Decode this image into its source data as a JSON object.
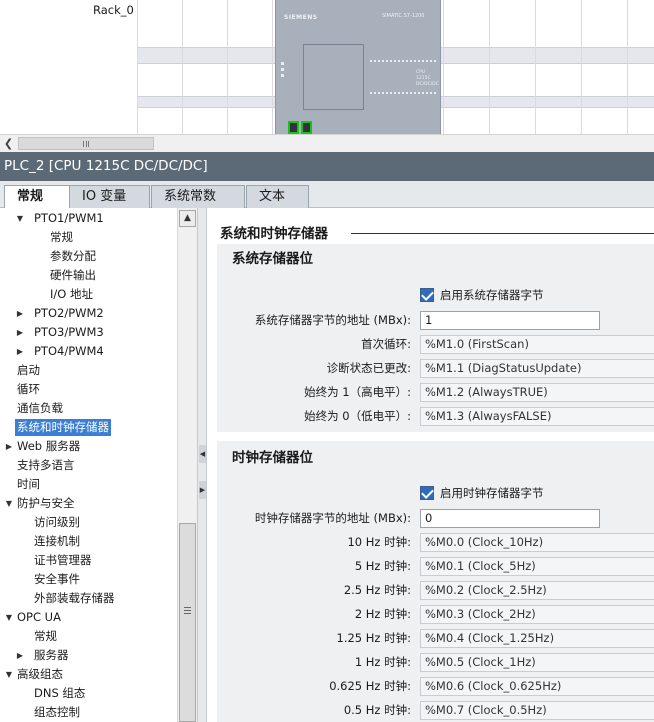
{
  "device_view": {
    "rack_label": "Rack_0",
    "plc_brand": "SIEMENS",
    "plc_model": "SIMATIC S7-1200",
    "plc_text": "CPU 1215C DC/DC/DC"
  },
  "title_bar": {
    "title": "PLC_2 [CPU 1215C DC/DC/DC]"
  },
  "tabs": [
    {
      "label": "常规",
      "active": true
    },
    {
      "label": "IO 变量",
      "active": false
    },
    {
      "label": "系统常数",
      "active": false
    },
    {
      "label": "文本",
      "active": false
    }
  ],
  "nav_tree": [
    {
      "label": "PTO1/PWM1",
      "level": 1,
      "expander": "expanded"
    },
    {
      "label": "常规",
      "level": 2,
      "expander": ""
    },
    {
      "label": "参数分配",
      "level": 2,
      "expander": ""
    },
    {
      "label": "硬件输出",
      "level": 2,
      "expander": ""
    },
    {
      "label": "I/O 地址",
      "level": 2,
      "expander": ""
    },
    {
      "label": "PTO2/PWM2",
      "level": 1,
      "expander": "collapsed"
    },
    {
      "label": "PTO3/PWM3",
      "level": 1,
      "expander": "collapsed"
    },
    {
      "label": "PTO4/PWM4",
      "level": 1,
      "expander": "collapsed"
    },
    {
      "label": "启动",
      "level": 0,
      "expander": ""
    },
    {
      "label": "循环",
      "level": 0,
      "expander": ""
    },
    {
      "label": "通信负载",
      "level": 0,
      "expander": ""
    },
    {
      "label": "系统和时钟存储器",
      "level": 0,
      "expander": "",
      "selected": true
    },
    {
      "label": "Web 服务器",
      "level": 0,
      "expander": "collapsed"
    },
    {
      "label": "支持多语言",
      "level": 0,
      "expander": ""
    },
    {
      "label": "时间",
      "level": 0,
      "expander": ""
    },
    {
      "label": "防护与安全",
      "level": 0,
      "expander": "expanded"
    },
    {
      "label": "访问级别",
      "level": 1,
      "expander": ""
    },
    {
      "label": "连接机制",
      "level": 1,
      "expander": ""
    },
    {
      "label": "证书管理器",
      "level": 1,
      "expander": ""
    },
    {
      "label": "安全事件",
      "level": 1,
      "expander": ""
    },
    {
      "label": "外部装载存储器",
      "level": 1,
      "expander": ""
    },
    {
      "label": "OPC UA",
      "level": 0,
      "expander": "expanded"
    },
    {
      "label": "常规",
      "level": 1,
      "expander": ""
    },
    {
      "label": "服务器",
      "level": 1,
      "expander": "collapsed"
    },
    {
      "label": "高级组态",
      "level": 0,
      "expander": "expanded"
    },
    {
      "label": "DNS 组态",
      "level": 1,
      "expander": ""
    },
    {
      "label": "组态控制",
      "level": 1,
      "expander": ""
    }
  ],
  "content": {
    "section_title": "系统和时钟存储器",
    "system_memory": {
      "header": "系统存储器位",
      "enable_label": "启用系统存储器字节",
      "enabled": true,
      "address_label": "系统存储器字节的地址 (MBx):",
      "address_value": "1",
      "bits": [
        {
          "label": "首次循环:",
          "value": "%M1.0 (FirstScan)"
        },
        {
          "label": "诊断状态已更改:",
          "value": "%M1.1 (DiagStatusUpdate)"
        },
        {
          "label": "始终为 1（高电平）:",
          "value": "%M1.2 (AlwaysTRUE)"
        },
        {
          "label": "始终为 0（低电平）:",
          "value": "%M1.3 (AlwaysFALSE)"
        }
      ]
    },
    "clock_memory": {
      "header": "时钟存储器位",
      "enable_label": "启用时钟存储器字节",
      "enabled": true,
      "address_label": "时钟存储器字节的地址 (MBx):",
      "address_value": "0",
      "bits": [
        {
          "label": "10 Hz 时钟:",
          "value": "%M0.0 (Clock_10Hz)"
        },
        {
          "label": "5 Hz 时钟:",
          "value": "%M0.1 (Clock_5Hz)"
        },
        {
          "label": "2.5 Hz 时钟:",
          "value": "%M0.2 (Clock_2.5Hz)"
        },
        {
          "label": "2 Hz 时钟:",
          "value": "%M0.3 (Clock_2Hz)"
        },
        {
          "label": "1.25 Hz 时钟:",
          "value": "%M0.4 (Clock_1.25Hz)"
        },
        {
          "label": "1 Hz 时钟:",
          "value": "%M0.5 (Clock_1Hz)"
        },
        {
          "label": "0.625 Hz 时钟:",
          "value": "%M0.6 (Clock_0.625Hz)"
        },
        {
          "label": "0.5 Hz 时钟:",
          "value": "%M0.7 (Clock_0.5Hz)"
        }
      ]
    }
  },
  "colors": {
    "title_bar": "#5c6a77",
    "selection": "#3b7fd4",
    "checkbox": "#2f6bbf",
    "group_bg": "#eef0f2"
  }
}
